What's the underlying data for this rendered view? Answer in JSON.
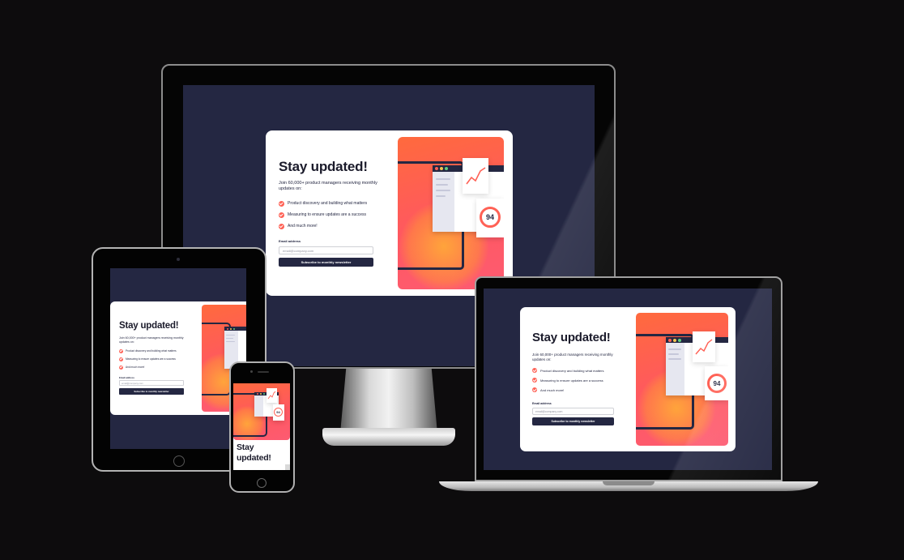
{
  "card": {
    "title": "Stay updated!",
    "intro": "Join 60,000+ product managers receiving monthly updates on:",
    "benefits": [
      "Product discovery and building what matters",
      "Measuring to ensure updates are a success",
      "And much more!"
    ],
    "email_label": "Email address",
    "email_placeholder": "email@company.com",
    "submit_label": "Subscribe to monthly newsletter"
  },
  "illustration": {
    "score": "94",
    "icons": [
      "window-icon",
      "chart-icon",
      "score-ring-icon"
    ]
  },
  "colors": {
    "backdrop": "#0d0c0d",
    "screen_bg": "#242742",
    "accent": "#ff6155",
    "card_bg": "#ffffff"
  },
  "devices": [
    "desktop-monitor",
    "laptop",
    "tablet",
    "phone"
  ]
}
